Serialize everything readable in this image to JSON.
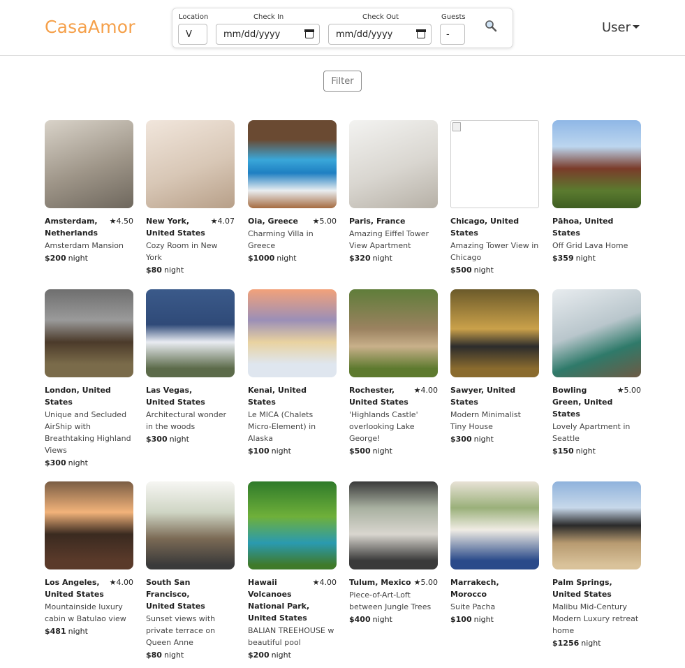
{
  "brand": {
    "name": "CasaAmor",
    "color": "#f5a04a"
  },
  "search": {
    "location_label": "Location",
    "location_value": "V",
    "checkin_label": "Check In",
    "checkin_value": "mm/dd/yyyy",
    "checkout_label": "Check Out",
    "checkout_value": "mm/dd/yyyy",
    "guests_label": "Guests",
    "guests_value": "-",
    "search_icon": "search-icon"
  },
  "user_menu": {
    "label": "User"
  },
  "filter": {
    "label": "Filter"
  },
  "night_label": "night",
  "listings": [
    {
      "location": "Amsterdam, Netherlands",
      "rating": "4.50",
      "title": "Amsterdam Mansion",
      "price": "$200"
    },
    {
      "location": "New York, United States",
      "rating": "4.07",
      "title": "Cozy Room in New York",
      "price": "$80"
    },
    {
      "location": "Oia, Greece",
      "rating": "5.00",
      "title": "Charming Villa in Greece",
      "price": "$1000"
    },
    {
      "location": "Paris, France",
      "rating": "",
      "title": "Amazing Eiffel Tower View Apartment",
      "price": "$320"
    },
    {
      "location": "Chicago, United States",
      "rating": "",
      "title": "Amazing Tower View in Chicago",
      "price": "$500"
    },
    {
      "location": "Pāhoa, United States",
      "rating": "",
      "title": "Off Grid Lava Home",
      "price": "$359"
    },
    {
      "location": "London, United States",
      "rating": "",
      "title": "Unique and Secluded AirShip with Breathtaking Highland Views",
      "price": "$300"
    },
    {
      "location": "Las Vegas, United States",
      "rating": "",
      "title": "Architectural wonder in the woods",
      "price": "$300"
    },
    {
      "location": "Kenai, United States",
      "rating": "",
      "title": "Le MICA (Chalets Micro-Element) in Alaska",
      "price": "$100"
    },
    {
      "location": "Rochester, United States",
      "rating": "4.00",
      "title": "'Highlands Castle' overlooking Lake George!",
      "price": "$500"
    },
    {
      "location": "Sawyer, United States",
      "rating": "",
      "title": "Modern Minimalist Tiny House",
      "price": "$300"
    },
    {
      "location": "Bowling Green, United States",
      "rating": "5.00",
      "title": "Lovely Apartment in Seattle",
      "price": "$150"
    },
    {
      "location": "Los Angeles, United States",
      "rating": "4.00",
      "title": "Mountainside luxury cabin w Batulao view",
      "price": "$481"
    },
    {
      "location": "South San Francisco, United States",
      "rating": "",
      "title": "Sunset views with private terrace on Queen Anne",
      "price": "$80"
    },
    {
      "location": "Hawaii Volcanoes National Park, United States",
      "rating": "4.00",
      "title": "BALIAN TREEHOUSE w beautiful pool",
      "price": "$200"
    },
    {
      "location": "Tulum, Mexico",
      "rating": "5.00",
      "title": "Piece-of-Art-Loft between Jungle Trees",
      "price": "$400"
    },
    {
      "location": "Marrakech, Morocco",
      "rating": "",
      "title": "Suite Pacha",
      "price": "$100"
    },
    {
      "location": "Palm Springs, United States",
      "rating": "",
      "title": "Malibu Mid-Century Modern Luxury retreat home",
      "price": "$1256"
    }
  ]
}
